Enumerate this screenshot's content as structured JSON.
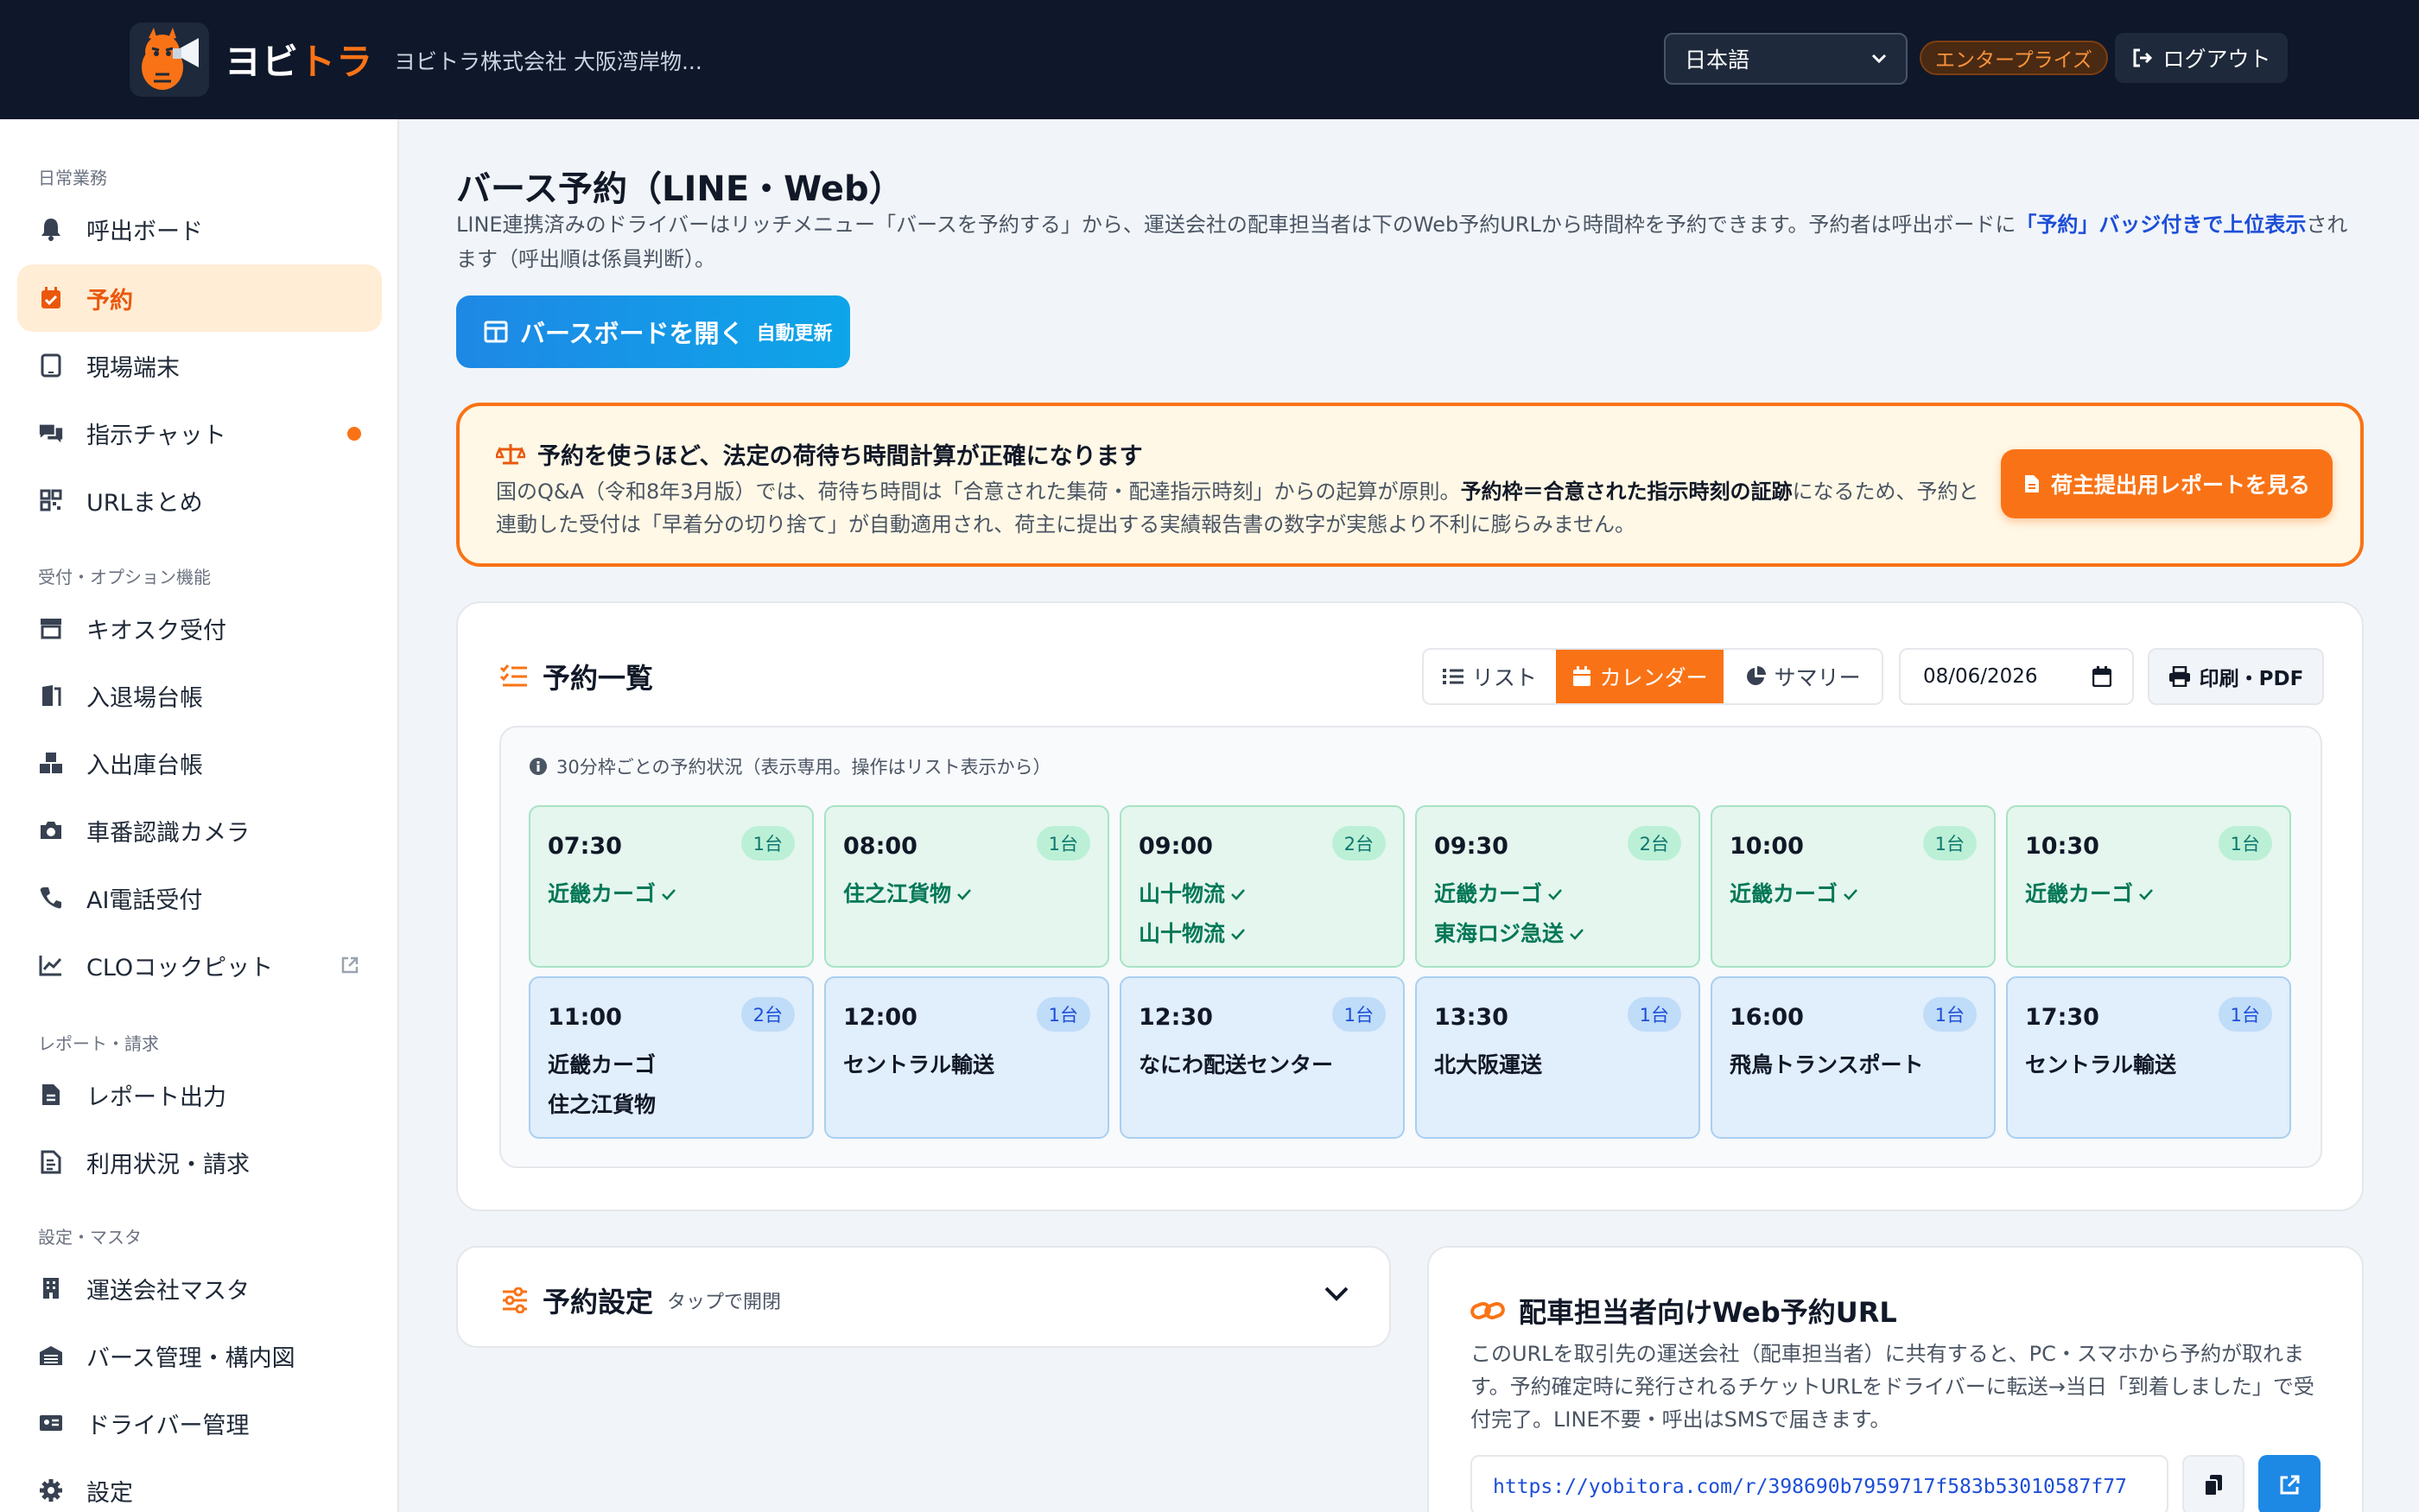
{
  "header": {
    "brand_prefix": "ヨビ",
    "brand_accent": "トラ",
    "company": "ヨビトラ株式会社 大阪湾岸物...",
    "language": "日本語",
    "plan_badge": "エンタープライズ",
    "logout": "ログアウト"
  },
  "sidebar": {
    "sections": [
      {
        "title": "日常業務",
        "items": [
          {
            "label": "呼出ボード",
            "icon": "bell-icon"
          },
          {
            "label": "予約",
            "icon": "calendar-check-icon",
            "active": true
          },
          {
            "label": "現場端末",
            "icon": "tablet-icon"
          },
          {
            "label": "指示チャット",
            "icon": "chat-icon",
            "dot": true
          },
          {
            "label": "URLまとめ",
            "icon": "qr-icon"
          }
        ]
      },
      {
        "title": "受付・オプション機能",
        "items": [
          {
            "label": "キオスク受付",
            "icon": "store-icon"
          },
          {
            "label": "入退場台帳",
            "icon": "door-icon"
          },
          {
            "label": "入出庫台帳",
            "icon": "boxes-icon"
          },
          {
            "label": "車番認識カメラ",
            "icon": "camera-icon"
          },
          {
            "label": "AI電話受付",
            "icon": "phone-icon"
          },
          {
            "label": "CLOコックピット",
            "icon": "chart-line-icon",
            "external": true
          }
        ]
      },
      {
        "title": "レポート・請求",
        "items": [
          {
            "label": "レポート出力",
            "icon": "file-icon"
          },
          {
            "label": "利用状況・請求",
            "icon": "invoice-icon"
          }
        ]
      },
      {
        "title": "設定・マスタ",
        "items": [
          {
            "label": "運送会社マスタ",
            "icon": "building-icon"
          },
          {
            "label": "バース管理・構内図",
            "icon": "warehouse-icon"
          },
          {
            "label": "ドライバー管理",
            "icon": "id-card-icon"
          },
          {
            "label": "設定",
            "icon": "gear-icon"
          }
        ]
      }
    ]
  },
  "main": {
    "title": "バース予約（LINE・Web）",
    "desc_1": "LINE連携済みのドライバーはリッチメニュー「バースを予約する」から、運送会社の配車担当者は下のWeb予約URLから時間枠を予約できます。予約者は呼出ボードに",
    "desc_hl": "「予約」バッジ付きで上位表示",
    "desc_2": "されます（呼出順は係員判断）。",
    "berth_board": "バースボードを開く",
    "berth_board_sub": "自動更新",
    "notice": {
      "title": "予約を使うほど、法定の荷待ち時間計算が正確になります",
      "body_1": "国のQ&A（令和8年3月版）では、荷待ち時間は「合意された集荷・配達指示時刻」からの起算が原則。",
      "body_bold": "予約枠＝合意された指示時刻の証跡",
      "body_2": "になるため、予約と連動した受付は「早着分の切り捨て」が自動適用され、荷主に提出する実績報告書の数字が実態より不利に膨らみません。",
      "button": "荷主提出用レポートを見る"
    },
    "list": {
      "title": "予約一覧",
      "views": [
        "リスト",
        "カレンダー",
        "サマリー"
      ],
      "active_view": "カレンダー",
      "date": "08/06/2026",
      "print": "印刷・PDF",
      "note": "30分枠ごとの予約状況（表示専用。操作はリスト表示から）",
      "slots": [
        {
          "time": "07:30",
          "count": "1台",
          "names": [
            "近畿カーゴ"
          ],
          "status": "arrived"
        },
        {
          "time": "08:00",
          "count": "1台",
          "names": [
            "住之江貨物"
          ],
          "status": "arrived"
        },
        {
          "time": "09:00",
          "count": "2台",
          "names": [
            "山十物流",
            "山十物流"
          ],
          "status": "arrived"
        },
        {
          "time": "09:30",
          "count": "2台",
          "names": [
            "近畿カーゴ",
            "東海ロジ急送"
          ],
          "status": "arrived"
        },
        {
          "time": "10:00",
          "count": "1台",
          "names": [
            "近畿カーゴ"
          ],
          "status": "arrived"
        },
        {
          "time": "10:30",
          "count": "1台",
          "names": [
            "近畿カーゴ"
          ],
          "status": "arrived"
        },
        {
          "time": "11:00",
          "count": "2台",
          "names": [
            "近畿カーゴ",
            "住之江貨物"
          ],
          "status": "booked"
        },
        {
          "time": "12:00",
          "count": "1台",
          "names": [
            "セントラル輸送"
          ],
          "status": "booked"
        },
        {
          "time": "12:30",
          "count": "1台",
          "names": [
            "なにわ配送センター"
          ],
          "status": "booked"
        },
        {
          "time": "13:30",
          "count": "1台",
          "names": [
            "北大阪運送"
          ],
          "status": "booked"
        },
        {
          "time": "16:00",
          "count": "1台",
          "names": [
            "飛鳥トランスポート"
          ],
          "status": "booked"
        },
        {
          "time": "17:30",
          "count": "1台",
          "names": [
            "セントラル輸送"
          ],
          "status": "booked"
        }
      ]
    },
    "settings": {
      "title": "予約設定",
      "hint": "タップで開閉"
    },
    "web_url": {
      "title": "配車担当者向けWeb予約URL",
      "desc": "このURLを取引先の運送会社（配車担当者）に共有すると、PC・スマホから予約が取れます。予約確定時に発行されるチケットURLをドライバーに転送→当日「到着しました」で受付完了。LINE不要・呼出はSMSで届きます。",
      "url": "https://yobitora.com/r/398690b7959717f583b53010587f77"
    }
  },
  "colors": {
    "accent": "#f97316",
    "primary": "#1e88e5",
    "arrived_bg": "#e4f6ee",
    "booked_bg": "#e1eefb"
  }
}
